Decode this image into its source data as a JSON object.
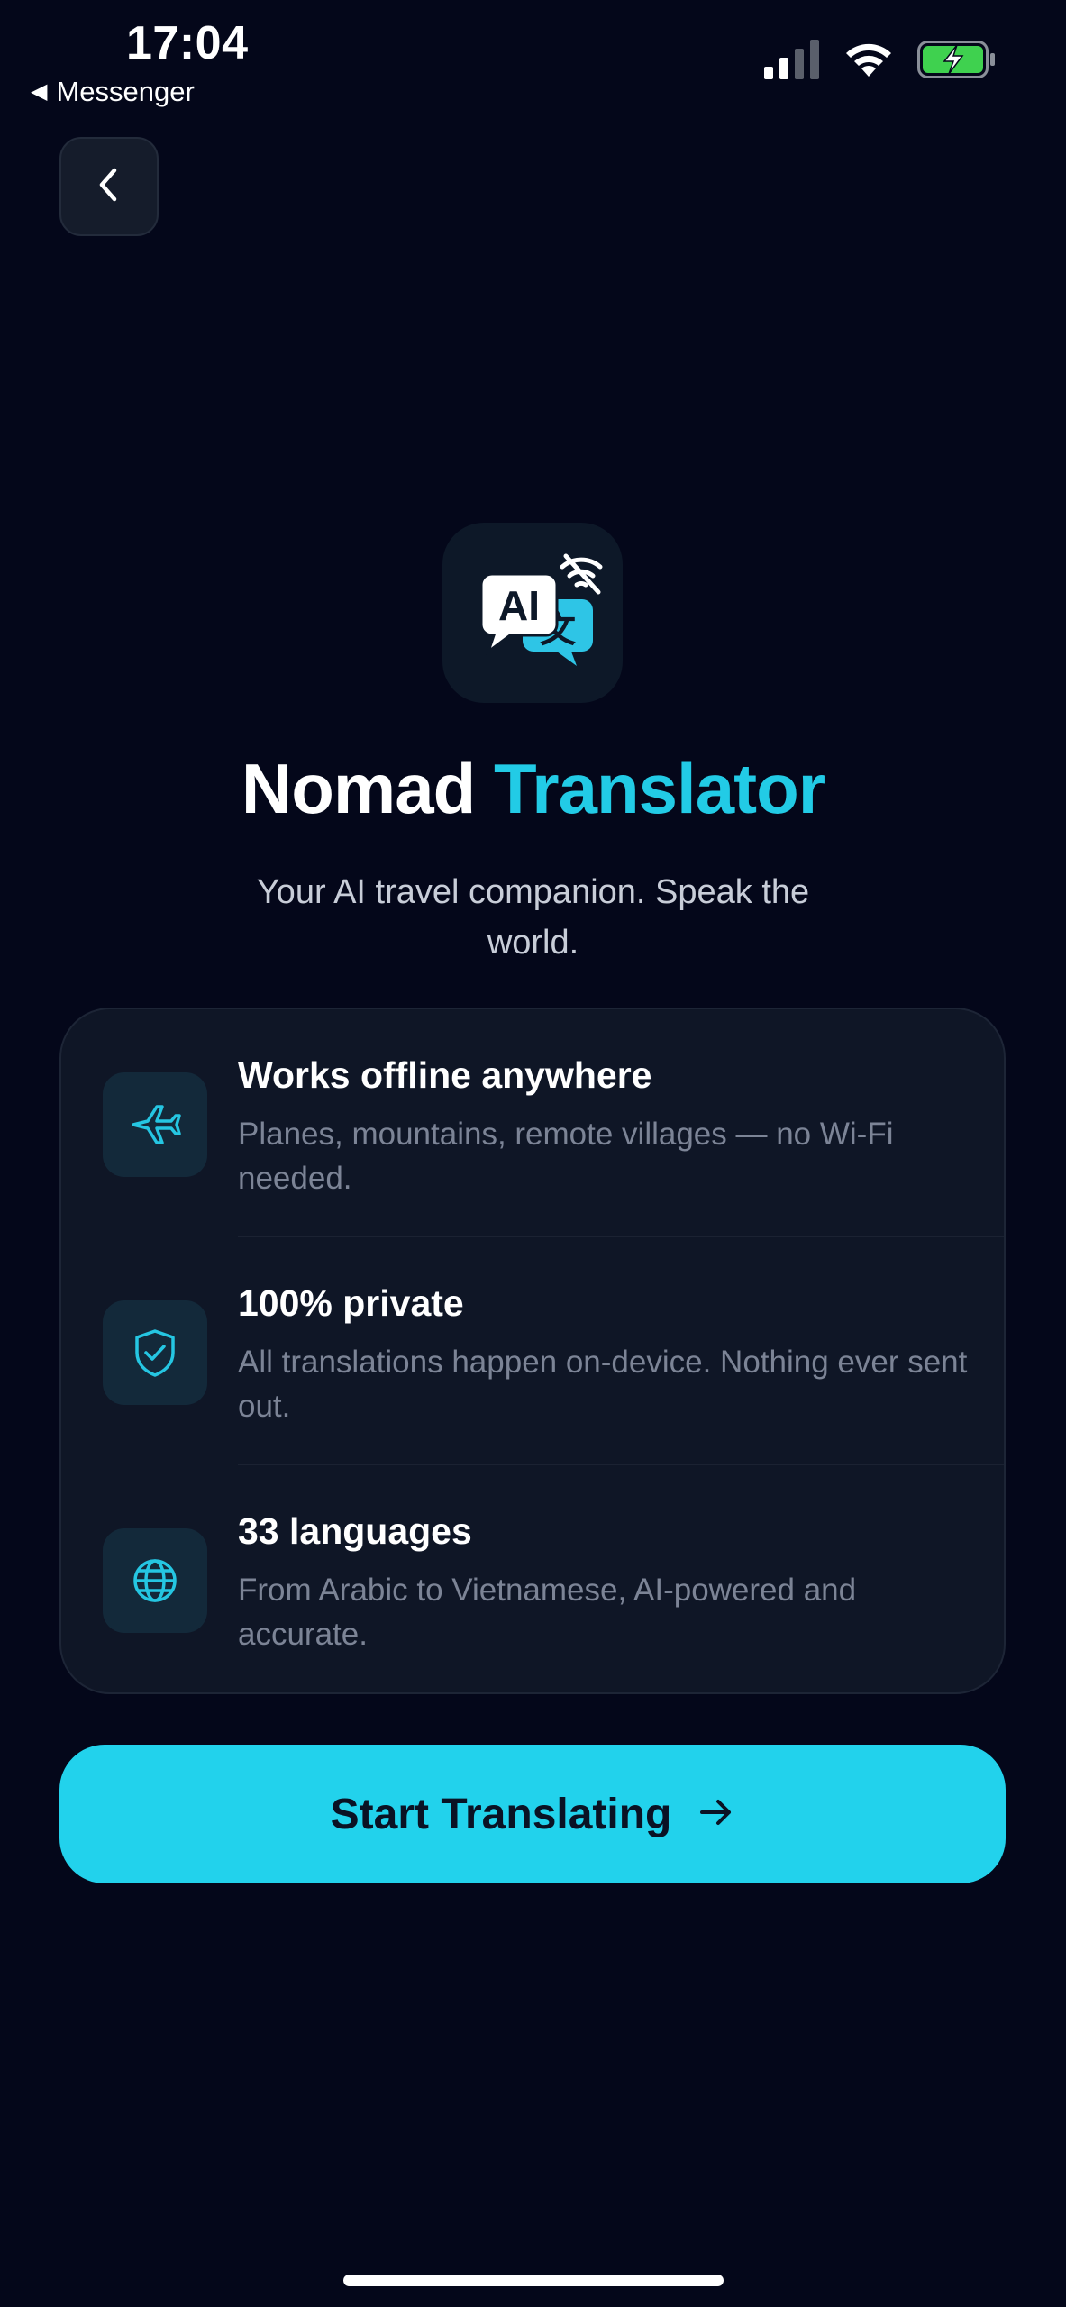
{
  "status_bar": {
    "time": "17:04",
    "back_app": "Messenger",
    "icons": [
      "signal-icon",
      "wifi-icon",
      "battery-charging-icon"
    ]
  },
  "header": {
    "back_icon": "chevron-left-icon"
  },
  "app": {
    "logo_icon": "ai-translate-offline-icon",
    "logo_text_ai": "AI",
    "logo_text_cjk": "文",
    "title_primary": "Nomad",
    "title_accent": "Translator",
    "tagline": "Your AI travel companion. Speak the world."
  },
  "features": [
    {
      "icon": "airplane-icon",
      "title": "Works offline anywhere",
      "description": "Planes, mountains, remote villages — no Wi-Fi needed."
    },
    {
      "icon": "shield-check-icon",
      "title": "100% private",
      "description": "All translations happen on-device. Nothing ever sent out."
    },
    {
      "icon": "globe-icon",
      "title": "33 languages",
      "description": "From Arabic to Vietnamese, AI-powered and accurate."
    }
  ],
  "cta": {
    "label": "Start Translating",
    "icon": "arrow-right-icon"
  },
  "colors": {
    "background": "#04071a",
    "accent": "#22cbe6",
    "card": "#0f1626",
    "button": "#22d2ec"
  }
}
